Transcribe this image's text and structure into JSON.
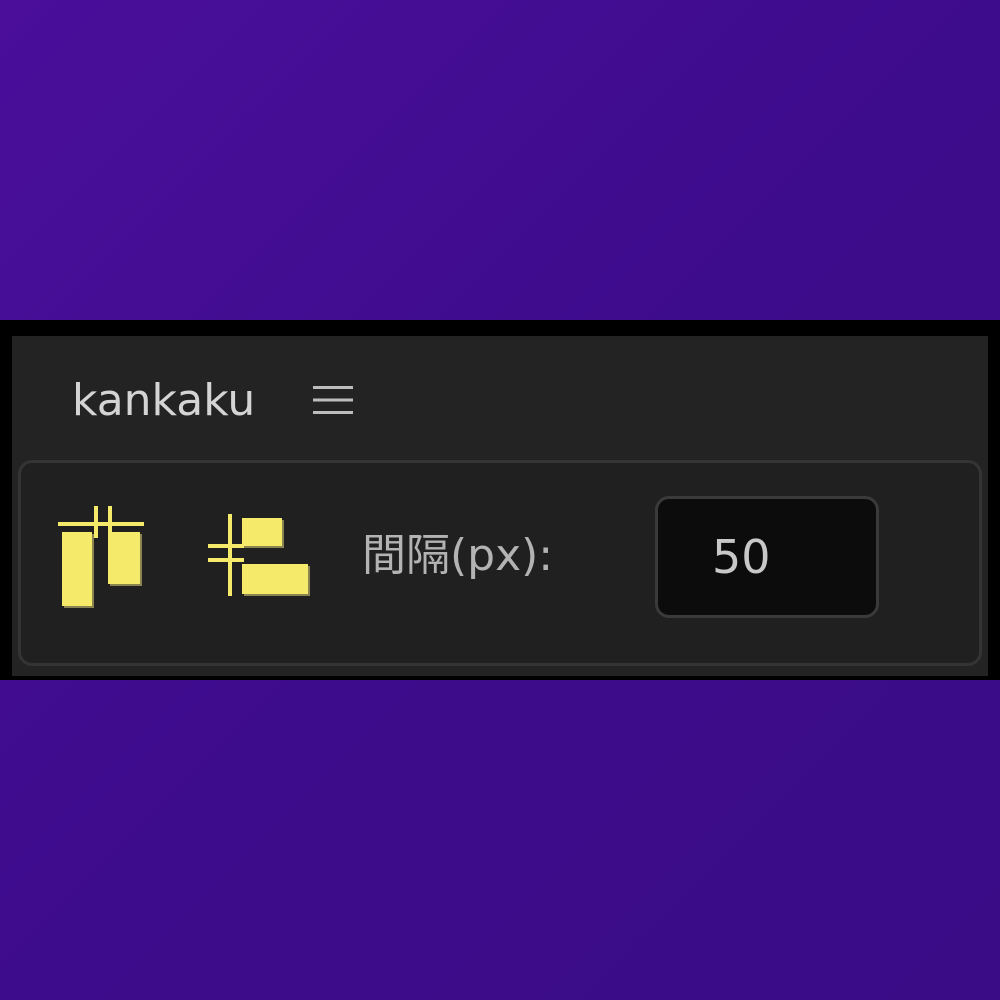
{
  "panel": {
    "title": "kankaku",
    "menu_icon": "hamburger-menu-icon"
  },
  "controls": {
    "vertical_spacing_icon": "distribute-vertical-spacing-icon",
    "horizontal_spacing_icon": "distribute-horizontal-spacing-icon",
    "spacing_label": "間隔(px):",
    "spacing_value": "50"
  },
  "colors": {
    "background": "#3d0c8c",
    "panel": "#232323",
    "icon_accent": "#f5ea6a",
    "text": "#d4d4d4"
  }
}
